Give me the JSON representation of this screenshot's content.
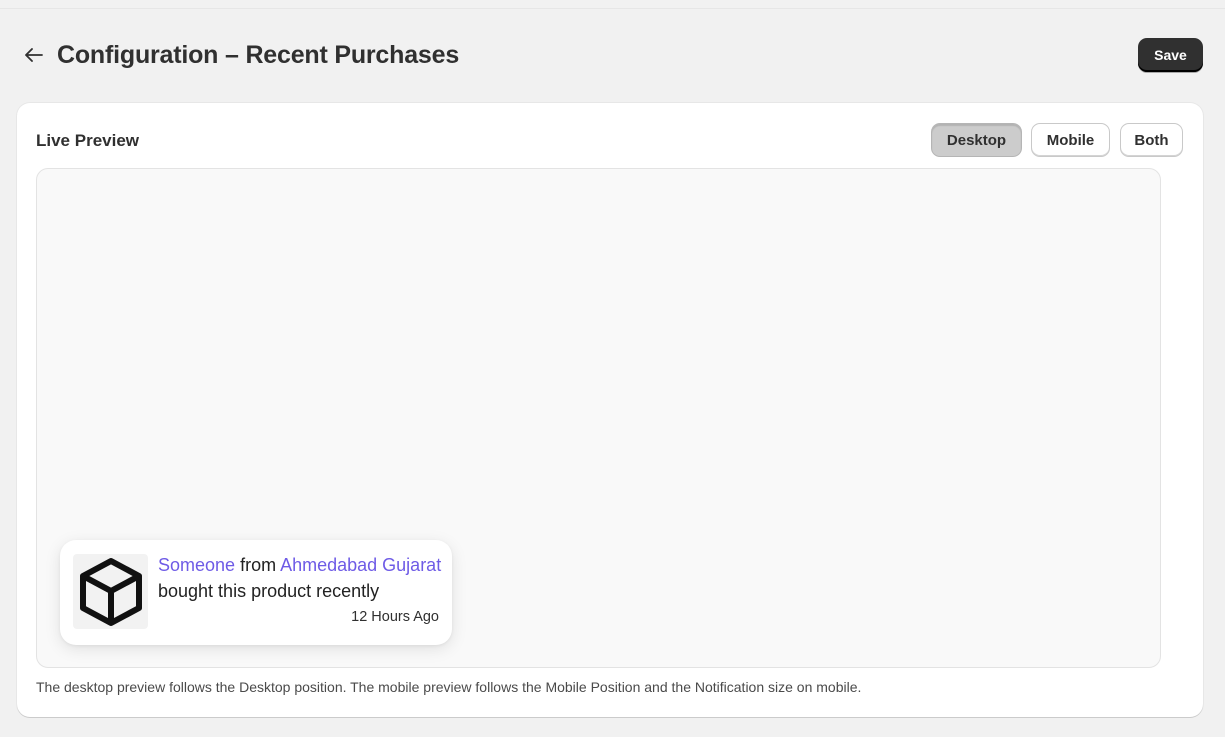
{
  "header": {
    "back_icon": "arrow-left-icon",
    "title": "Configuration – Recent Purchases",
    "save_label": "Save"
  },
  "card": {
    "title": "Live Preview",
    "toggles": [
      {
        "label": "Desktop",
        "active": true
      },
      {
        "label": "Mobile",
        "active": false
      },
      {
        "label": "Both",
        "active": false
      }
    ],
    "help_text": "The desktop preview follows the Desktop position. The mobile preview follows the Mobile Position and the Notification size on mobile."
  },
  "popup": {
    "product_icon": "box-icon",
    "who": "Someone",
    "from": "from",
    "location": "Ahmedabad Gujarat",
    "action": "bought this product recently",
    "time": "12 Hours Ago"
  },
  "colors": {
    "accent": "#6e5be6",
    "primary_button": "#303030",
    "background": "#f1f1f1"
  }
}
